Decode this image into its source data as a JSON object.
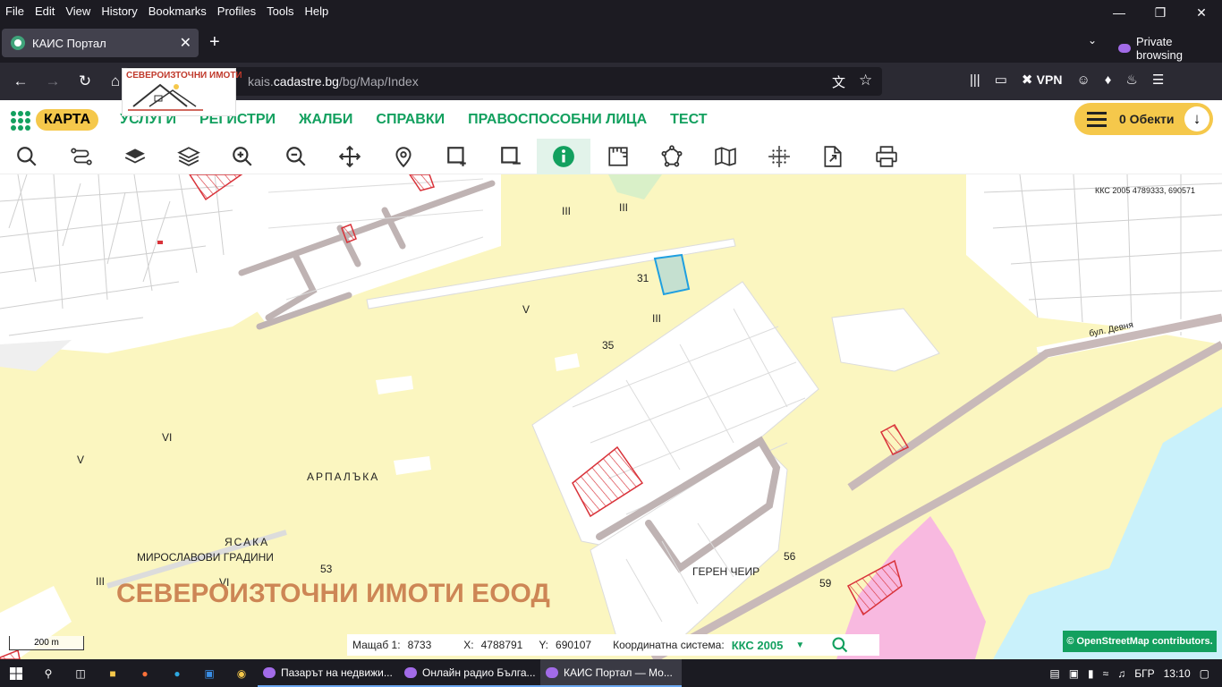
{
  "browser": {
    "menu": [
      "File",
      "Edit",
      "View",
      "History",
      "Bookmarks",
      "Profiles",
      "Tools",
      "Help"
    ],
    "tab_title": "КАИС Портал",
    "private_label": "Private browsing",
    "url_prefix": "kais.",
    "url_domain": "cadastre.bg",
    "url_path": "/bg/Map/Index",
    "vpn_label": "VPN"
  },
  "logo": {
    "text": "СЕВЕРОИЗТОЧНИ ИМОТИ"
  },
  "site": {
    "nav": [
      "КАРТА",
      "УСЛУГИ",
      "РЕГИСТРИ",
      "ЖАЛБИ",
      "СПРАВКИ",
      "ПРАВОСПОСОБНИ ЛИЦА",
      "ТЕСТ"
    ],
    "objects_label": "0 Обекти"
  },
  "map_tools": [
    "search-icon",
    "route-icon",
    "layer-icon",
    "layers-icon",
    "zoom-in-icon",
    "zoom-out-icon",
    "pan-icon",
    "marker-icon",
    "add-rectangle-icon",
    "remove-rectangle-icon",
    "info-icon",
    "measure-icon",
    "polygon-icon",
    "map-icon",
    "crosshair-icon",
    "export-icon",
    "print-icon"
  ],
  "map": {
    "coords_readout": "ККС 2005 4789333, 690571",
    "labels": {
      "iii_1": "III",
      "iii_2": "III",
      "iii_3": "III",
      "iii_4": "III",
      "v_1": "V",
      "v_2": "V",
      "vi_1": "VI",
      "vi_2": "VI",
      "n31": "31",
      "n35": "35",
      "n53": "53",
      "n56": "56",
      "n59": "59",
      "arpalaka": "АРПАЛЪКА",
      "yasaka": "ЯСАКА",
      "miroslavovi": "МИРОСЛАВОВИ ГРАДИНИ",
      "geren": "ГЕРЕН ЧЕИР",
      "devnya": "бул. Девня"
    },
    "watermark": "СЕВЕРОИЗТОЧНИ ИМОТИ ЕООД",
    "scale": "200 m",
    "osm_credit": "© OpenStreetMap contributors."
  },
  "status": {
    "scale_label": "Мащаб 1:",
    "scale_value": "8733",
    "x_label": "X:",
    "x_value": "4788791",
    "y_label": "Y:",
    "y_value": "690107",
    "crs_label": "Координатна система:",
    "crs_value": "ККС 2005"
  },
  "taskbar": {
    "tasks": [
      "Пазарът на недвижи...",
      "Онлайн радио Бълга...",
      "КАИС Портал — Мо..."
    ],
    "lang": "БГР",
    "time": "13:10"
  },
  "colors": {
    "accent_green": "#13a05f",
    "accent_yellow": "#f5c84b",
    "map_land": "#fbf6c0",
    "map_water": "#c9f1fb",
    "map_pink": "#f8b9e0"
  }
}
